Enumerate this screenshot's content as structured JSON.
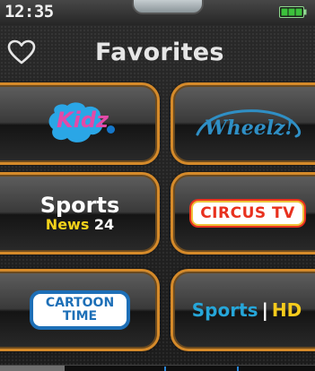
{
  "status_bar": {
    "time": "12:35",
    "battery_icon": "battery-icon",
    "battery_color": "#3cc23c"
  },
  "header": {
    "title": "Favorites",
    "favorite_icon": "heart-outline-icon"
  },
  "tiles": [
    {
      "id": "kidz",
      "logo_text": "Kidz"
    },
    {
      "id": "wheelz",
      "logo_text": "Wheelz!"
    },
    {
      "id": "sports-news",
      "logo_title": "Sports",
      "logo_sub_word": "News",
      "logo_sub_num": "24"
    },
    {
      "id": "circus",
      "logo_text": "CIRCUS TV"
    },
    {
      "id": "cartoon",
      "logo_line1": "CARTOON",
      "logo_line2": "TIME"
    },
    {
      "id": "sports-hd",
      "logo_word": "Sports",
      "logo_separator": "|",
      "logo_hd": "HD"
    }
  ],
  "colors": {
    "tile_border": "#d58a2a",
    "kidz_text": "#e24aa8",
    "kidz_blob": "#2aa6e6",
    "wheelz_text": "#2f8fc5",
    "sports_news_accent": "#f2d21a",
    "circus_red": "#e8311e",
    "cartoon_blue": "#1d6fb7",
    "sports_hd_blue": "#26a6d9",
    "sports_hd_yellow": "#f5cb1c"
  }
}
